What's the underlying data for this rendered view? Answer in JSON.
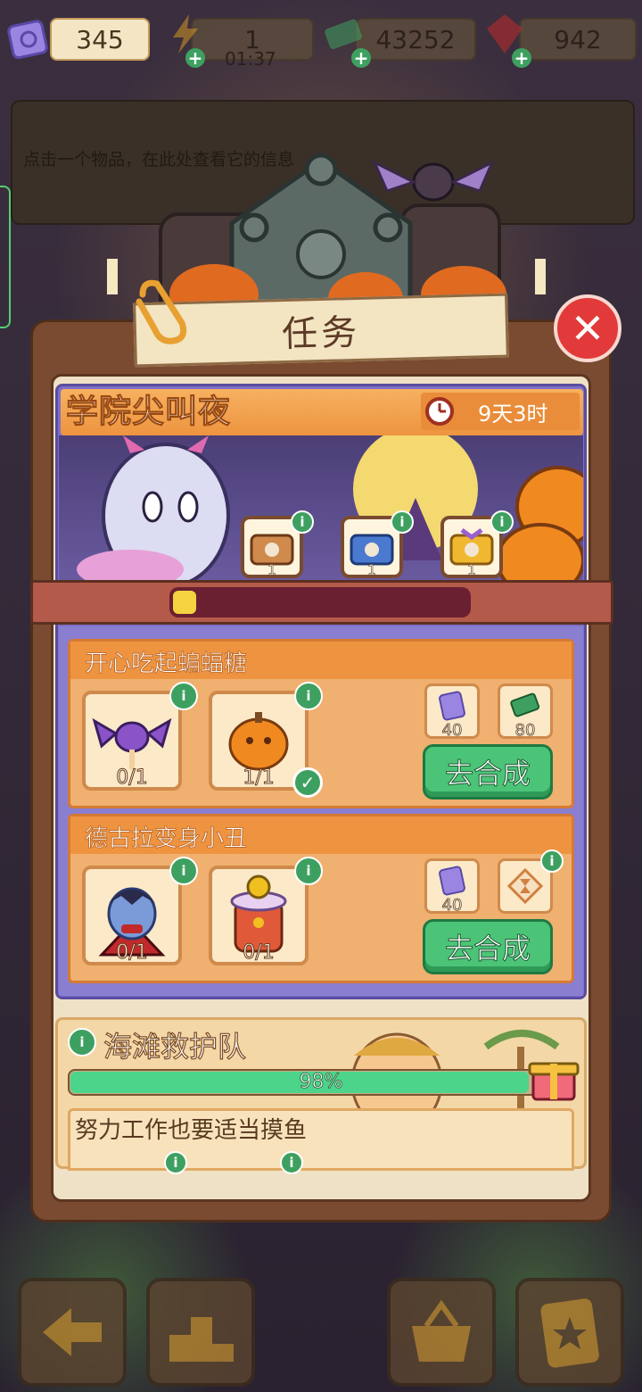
{
  "currencies": {
    "tickets": "345",
    "energy": "1",
    "energy_timer": "01:37",
    "cash": "43252",
    "gems": "942"
  },
  "info_box": {
    "hint": "点击一个物品，在此处查看它的信息"
  },
  "panel": {
    "title": "任务",
    "close_label": "✕"
  },
  "event": {
    "title": "学院尖叫夜",
    "time_left": "9天3时",
    "chests": [
      {
        "icon": "wooden-skull-chest-icon",
        "count": "1"
      },
      {
        "icon": "blue-skull-chest-icon",
        "count": "1"
      },
      {
        "icon": "golden-skull-chest-icon",
        "count": "1"
      }
    ],
    "progress_fraction": 0.08
  },
  "tasks": [
    {
      "title": "开心吃起蝙蝠糖",
      "items": [
        {
          "icon": "bat-candy-icon",
          "count": "0/1",
          "done": false
        },
        {
          "icon": "pumpkin-candy-icon",
          "count": "1/1",
          "done": true
        }
      ],
      "rewards": [
        {
          "icon": "ticket-icon",
          "amount": "40"
        },
        {
          "icon": "cash-icon",
          "amount": "80"
        }
      ],
      "button": "去合成"
    },
    {
      "title": "德古拉变身小丑",
      "items": [
        {
          "icon": "dracula-icon",
          "count": "0/1",
          "done": false
        },
        {
          "icon": "clown-costume-icon",
          "count": "0/1",
          "done": false
        }
      ],
      "rewards": [
        {
          "icon": "ticket-icon",
          "amount": "40"
        },
        {
          "icon": "hourglass-card-icon",
          "amount": ""
        }
      ],
      "button": "去合成"
    }
  ],
  "beach": {
    "title": "海滩救护队",
    "progress_label": "98%",
    "progress_fraction": 0.98,
    "sub_task_title": "努力工作也要适当摸鱼"
  },
  "colors": {
    "accent_green": "#4cc478",
    "orange": "#ee9440",
    "purple": "#7e70c8"
  }
}
